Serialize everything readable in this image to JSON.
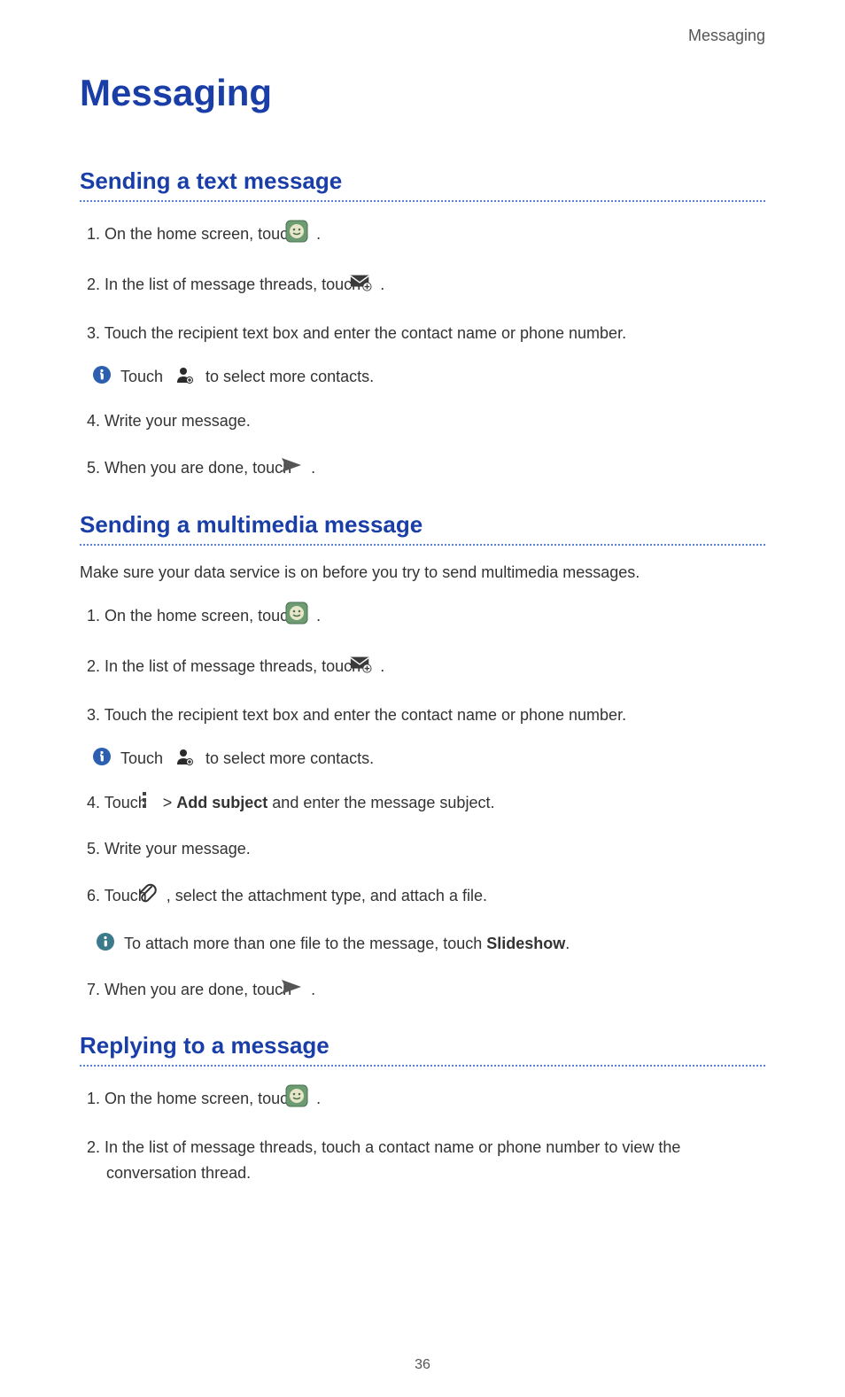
{
  "header_label": "Messaging",
  "page_title": "Messaging",
  "page_number": "36",
  "section1": {
    "title": "Sending a text message",
    "steps": {
      "s1_pre": "1. On the home screen, touch ",
      "s1_post": " .",
      "s2_pre": "2. In the list of message threads, touch ",
      "s2_post": ".",
      "s3": "3. Touch the recipient text box and enter the contact name or phone number.",
      "info_pre": "Touch ",
      "info_post": " to select more contacts.",
      "s4": "4. Write your message.",
      "s5_pre": "5. When you are done, touch ",
      "s5_post": " ."
    }
  },
  "section2": {
    "title": "Sending a multimedia message",
    "intro": "Make sure your data service is on before you try to send multimedia messages.",
    "steps": {
      "s1_pre": "1. On the home screen, touch ",
      "s1_post": " .",
      "s2_pre": "2. In the list of message threads, touch ",
      "s2_post": ".",
      "s3": "3. Touch the recipient text box and enter the contact name or phone number.",
      "info_pre": "Touch ",
      "info_post": " to select more contacts.",
      "s4_pre": "4. Touch ",
      "s4_mid1": " > ",
      "s4_bold": "Add subject",
      "s4_post": " and enter the message subject.",
      "s5": "5. Write your message.",
      "s6_pre": "6. Touch ",
      "s6_post": " , select the attachment type, and attach a file.",
      "info2_pre": "To attach more than one file to the message, touch ",
      "info2_bold": "Slideshow",
      "info2_post": ".",
      "s7_pre": "7. When you are done, touch ",
      "s7_post": " ."
    }
  },
  "section3": {
    "title": "Replying to a message",
    "steps": {
      "s1_pre": "1. On the home screen, touch ",
      "s1_post": " .",
      "s2": "2. In the list of message threads, touch a contact name or phone number to view the conversation thread."
    }
  }
}
